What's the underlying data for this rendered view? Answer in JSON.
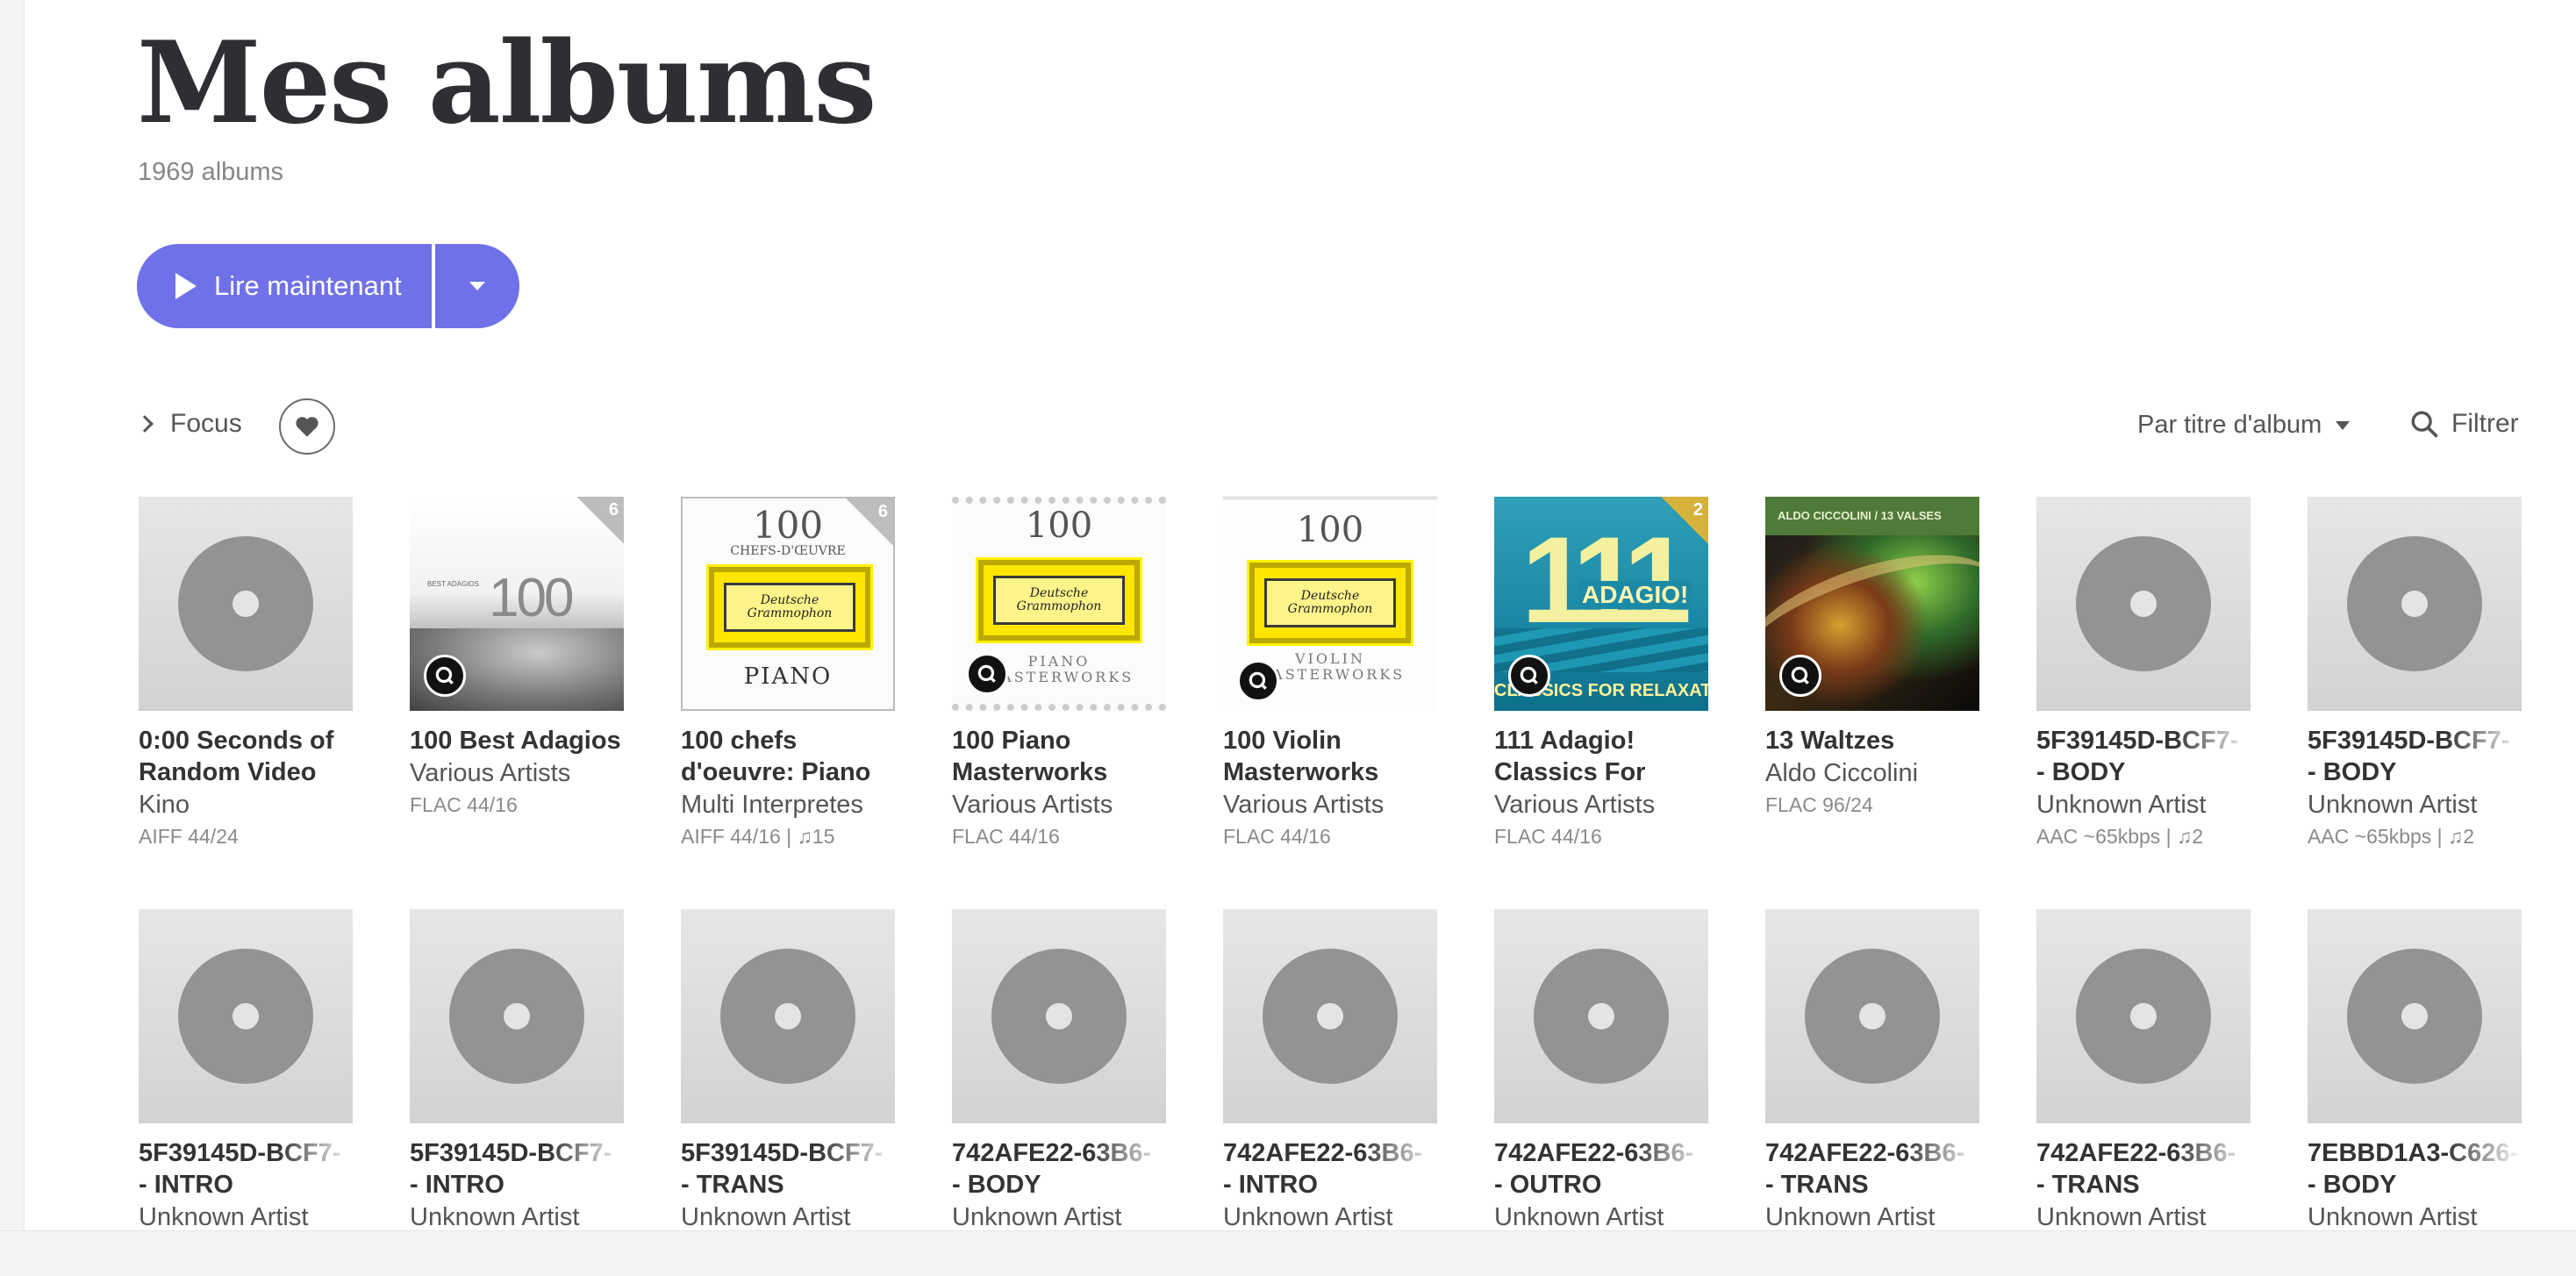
{
  "header": {
    "title": "Mes albums",
    "count": "1969 albums"
  },
  "actions": {
    "play_label": "Lire maintenant"
  },
  "toolbar": {
    "focus_label": "Focus",
    "sort_label": "Par titre d'album",
    "filter_label": "Filtrer"
  },
  "colors": {
    "accent": "#7071e8",
    "placeholder_disc": "#939393"
  },
  "albums": [
    {
      "title1": "0:00 Seconds of",
      "title2": "Random Video",
      "artist": "Kino",
      "meta": "AIFF 44/24",
      "cover": "placeholder"
    },
    {
      "title1": "100 Best Adagios",
      "title2": "",
      "artist": "Various Artists",
      "meta": "FLAC 44/16",
      "cover": "best-adagios",
      "corner": "6",
      "cover_text_small": "BEST ADAGIOS",
      "cover_text_big": "100"
    },
    {
      "title1": "100 chefs",
      "title2": "d'oeuvre: Piano",
      "artist": "Multi Interpretes",
      "meta": "AIFF 44/16 | ♫15",
      "cover": "dg-piano",
      "corner": "6",
      "cover_top": "100",
      "cover_sub": "CHEFS-D'ŒUVRE",
      "cover_bottom": "PIANO",
      "dg_text": "Deutsche Grammophon"
    },
    {
      "title1": "100 Piano",
      "title2": "Masterworks",
      "artist": "Various Artists",
      "meta": "FLAC 44/16",
      "cover": "dg-piano-master",
      "cover_top": "100",
      "cover_bottom1": "PIANO",
      "cover_bottom2": "MASTERWORKS",
      "dg_text": "Deutsche Grammophon"
    },
    {
      "title1": "100 Violin",
      "title2": "Masterworks",
      "artist": "Various Artists",
      "meta": "FLAC 44/16",
      "cover": "dg-violin",
      "cover_top": "100",
      "cover_bottom1": "VIOLIN",
      "cover_bottom2": "MASTERWORKS",
      "dg_text": "Deutsche Grammophon"
    },
    {
      "title1": "111 Adagio!",
      "title2": "Classics For",
      "artist": "Various Artists",
      "meta": "FLAC 44/16",
      "cover": "adagio-111",
      "corner": "2",
      "cover_big": "111",
      "cover_mid": "ADAGIO!",
      "cover_bottom": "CLASSICS FOR RELAXATION"
    },
    {
      "title1": "13 Waltzes",
      "title2": "",
      "artist": "Aldo Ciccolini",
      "meta": "FLAC 96/24",
      "cover": "waltzes",
      "cover_band": "ALDO CICCOLINI / 13 VALSES"
    },
    {
      "title1": "5F39145D-BCF7-",
      "title2": "- BODY",
      "artist": "Unknown Artist",
      "meta": "AAC ~65kbps | ♫2",
      "cover": "placeholder"
    },
    {
      "title1": "5F39145D-BCF7-",
      "title2": "- BODY",
      "artist": "Unknown Artist",
      "meta": "AAC ~65kbps | ♫2",
      "cover": "placeholder"
    },
    {
      "title1": "5F39145D-BCF7-",
      "title2": "- INTRO",
      "artist": "Unknown Artist",
      "meta": "",
      "cover": "placeholder"
    },
    {
      "title1": "5F39145D-BCF7-",
      "title2": "- INTRO",
      "artist": "Unknown Artist",
      "meta": "",
      "cover": "placeholder"
    },
    {
      "title1": "5F39145D-BCF7-",
      "title2": "- TRANS",
      "artist": "Unknown Artist",
      "meta": "",
      "cover": "placeholder"
    },
    {
      "title1": "742AFE22-63B6-",
      "title2": "- BODY",
      "artist": "Unknown Artist",
      "meta": "",
      "cover": "placeholder"
    },
    {
      "title1": "742AFE22-63B6-",
      "title2": "- INTRO",
      "artist": "Unknown Artist",
      "meta": "",
      "cover": "placeholder"
    },
    {
      "title1": "742AFE22-63B6-",
      "title2": "- OUTRO",
      "artist": "Unknown Artist",
      "meta": "",
      "cover": "placeholder"
    },
    {
      "title1": "742AFE22-63B6-",
      "title2": "- TRANS",
      "artist": "Unknown Artist",
      "meta": "",
      "cover": "placeholder"
    },
    {
      "title1": "742AFE22-63B6-",
      "title2": "- TRANS",
      "artist": "Unknown Artist",
      "meta": "",
      "cover": "placeholder"
    },
    {
      "title1": "7EBBD1A3-C626-",
      "title2": "- BODY",
      "artist": "Unknown Artist",
      "meta": "",
      "cover": "placeholder"
    }
  ]
}
